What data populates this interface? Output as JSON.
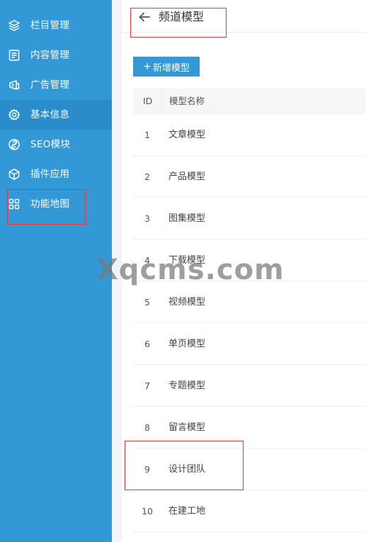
{
  "sidebar": {
    "items": [
      {
        "label": "栏目管理",
        "icon": "layers-icon"
      },
      {
        "label": "内容管理",
        "icon": "document-icon"
      },
      {
        "label": "广告管理",
        "icon": "ad-icon"
      },
      {
        "label": "基本信息",
        "icon": "gear-icon",
        "active": true
      },
      {
        "label": "SEO模块",
        "icon": "link-icon"
      },
      {
        "label": "插件应用",
        "icon": "cube-icon"
      },
      {
        "label": "功能地图",
        "icon": "grid-icon"
      }
    ]
  },
  "header": {
    "title": "频道模型"
  },
  "toolbar": {
    "add_icon": "+",
    "add_label": "新增模型"
  },
  "table": {
    "columns": [
      "ID",
      "模型名称"
    ],
    "rows": [
      {
        "id": "1",
        "name": "文章模型"
      },
      {
        "id": "2",
        "name": "产品模型"
      },
      {
        "id": "3",
        "name": "图集模型"
      },
      {
        "id": "4",
        "name": "下载模型"
      },
      {
        "id": "5",
        "name": "视频模型"
      },
      {
        "id": "6",
        "name": "单页模型"
      },
      {
        "id": "7",
        "name": "专题模型"
      },
      {
        "id": "8",
        "name": "留言模型"
      },
      {
        "id": "9",
        "name": "设计团队"
      },
      {
        "id": "10",
        "name": "在建工地"
      }
    ]
  },
  "watermark": "Xqcms.com",
  "colors": {
    "sidebar_bg": "#3399d6",
    "sidebar_active": "#2a8ccb",
    "accent": "#3399d6",
    "highlight_border": "#e03b3b"
  }
}
